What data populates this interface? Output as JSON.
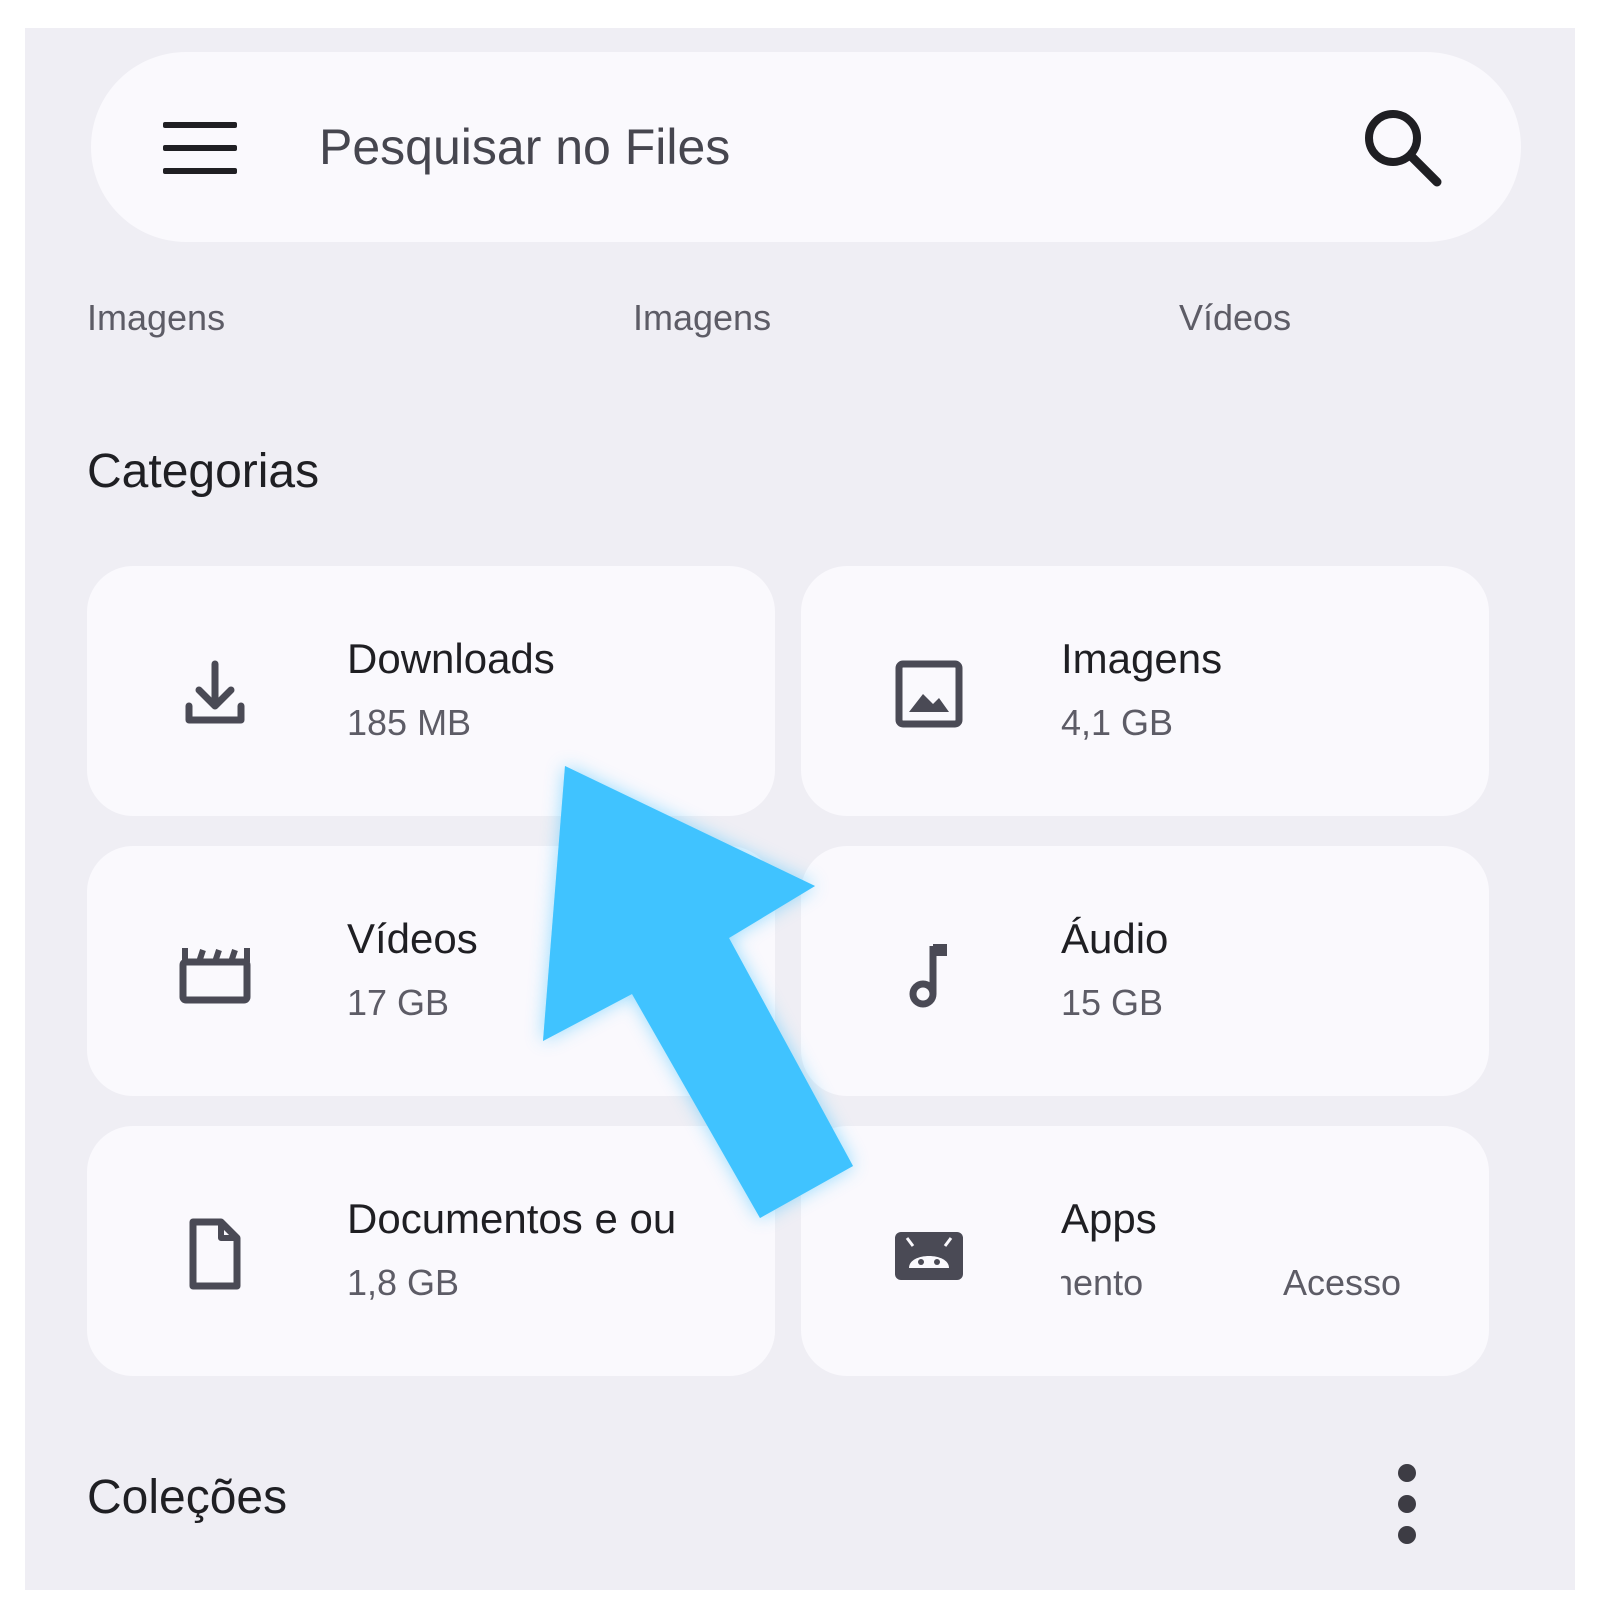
{
  "search": {
    "placeholder": "Pesquisar no Files",
    "menu_icon": "hamburger-menu-icon",
    "search_icon": "magnifier-icon"
  },
  "recent_labels": [
    "Imagens",
    "Imagens",
    "Vídeos"
  ],
  "categories": {
    "title": "Categorias",
    "items": [
      {
        "name": "Downloads",
        "size": "185 MB",
        "icon": "download-icon"
      },
      {
        "name": "Imagens",
        "size": "4,1 GB",
        "icon": "image-icon"
      },
      {
        "name": "Vídeos",
        "size": "17 GB",
        "icon": "movie-clapper-icon"
      },
      {
        "name": "Áudio",
        "size": "15 GB",
        "icon": "music-note-icon"
      },
      {
        "name": "Documentos e ou",
        "size": "1,8 GB",
        "icon": "document-icon"
      },
      {
        "name": "Apps",
        "size_fragments": [
          "nento",
          "Acesso"
        ],
        "icon": "android-icon"
      }
    ]
  },
  "collections": {
    "title": "Coleções",
    "more_icon": "more-vertical-icon"
  },
  "annotation": {
    "type": "pointer-arrow",
    "color": "#40c3ff",
    "points_to": "Downloads"
  }
}
